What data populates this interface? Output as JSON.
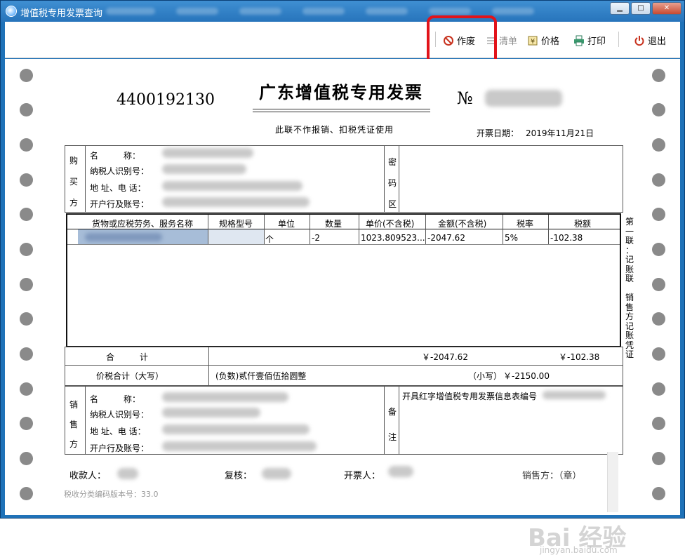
{
  "window": {
    "title": "增值税专用发票查询",
    "controls": {
      "minimize": "▁",
      "maximize": "□",
      "close": "✕"
    }
  },
  "toolbar": {
    "void_label": "作废",
    "list_label": "清单",
    "price_label": "价格",
    "print_label": "打印",
    "exit_label": "退出"
  },
  "invoice": {
    "code": "4400192130",
    "title": "广东增值税专用发票",
    "no_label": "№",
    "notice": "此联不作报销、扣税凭证使用",
    "date_label": "开票日期：",
    "date_value": "2019年11月21日",
    "buyer": {
      "side_label": [
        "购",
        "买",
        "方"
      ],
      "name_label": "名　　　称：",
      "taxid_label": "纳税人识别号：",
      "addr_label": "地 址、电 话：",
      "bank_label": "开户行及账号："
    },
    "cipher_label": [
      "密",
      "码",
      "区"
    ],
    "table": {
      "headers": [
        "货物或应税劳务、服务名称",
        "规格型号",
        "单位",
        "数量",
        "单价(不含税)",
        "金额(不含税)",
        "税率",
        "税额"
      ],
      "row": [
        "",
        "",
        "个",
        "-2",
        "1023.809523...",
        "-2047.62",
        "5%",
        "-102.38"
      ]
    },
    "total_label": "合　　　计",
    "total_amount": "￥-2047.62",
    "total_tax": "￥-102.38",
    "price_tax_label": "价税合计（大写）",
    "price_tax_upper": "(负数)贰仟壹佰伍拾圆整",
    "small_label": "（小写）",
    "small_value": "￥-2150.00",
    "seller": {
      "side_label": [
        "销",
        "售",
        "方"
      ],
      "name_label": "名　　　称：",
      "taxid_label": "纳税人识别号：",
      "addr_label": "地 址、电 话：",
      "bank_label": "开户行及账号："
    },
    "remark_label": [
      "备",
      "注"
    ],
    "remark_text": "开具红字增值税专用发票信息表编号",
    "payee_label": "收款人：",
    "reviewer_label": "复核：",
    "drawer_label": "开票人：",
    "seller_sign_label": "销售方：（章）",
    "version_text": "税收分类编码版本号：33.0",
    "copy_label": [
      "第",
      "一",
      "联",
      "：",
      "记",
      "账",
      "联",
      "　",
      "销",
      "售",
      "方",
      "记",
      "账",
      "凭",
      "证"
    ]
  },
  "watermark": {
    "main": "Bai 经验",
    "sub": "jingyan.baidu.com"
  },
  "colors": {
    "highlight": "#e2131a",
    "titlebar": "#2774bb"
  }
}
